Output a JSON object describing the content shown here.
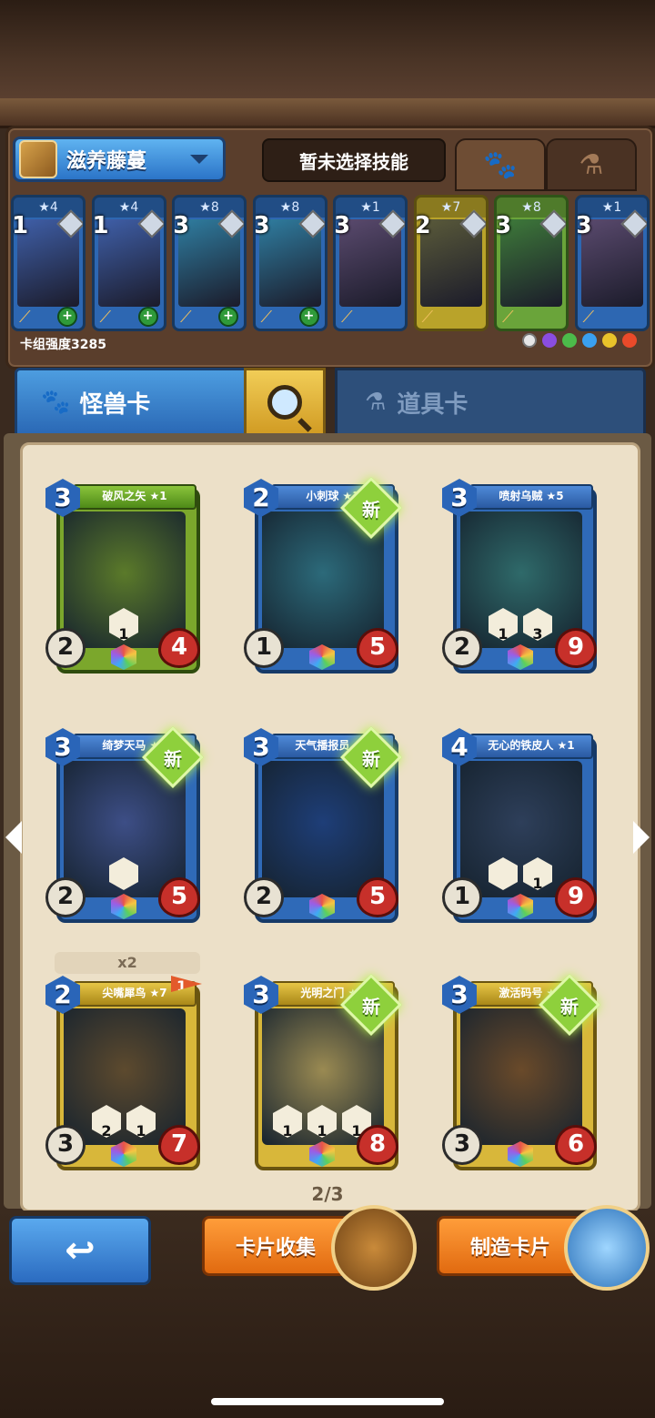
{
  "deck": {
    "name": "滋养藤蔓",
    "skill": "暂未选择技能",
    "power": "卡组强度3285",
    "cards": [
      {
        "cost": "1",
        "stars": "★4",
        "color": "blue",
        "art": "#3f5fa8"
      },
      {
        "cost": "1",
        "stars": "★4",
        "color": "blue",
        "art": "#3f5fa8"
      },
      {
        "cost": "3",
        "stars": "★8",
        "color": "blue",
        "art": "#2f7da0"
      },
      {
        "cost": "3",
        "stars": "★8",
        "color": "blue",
        "art": "#2f7da0"
      },
      {
        "cost": "3",
        "stars": "★1",
        "color": "blue",
        "art": "#5a4a6e"
      },
      {
        "cost": "2",
        "stars": "★7",
        "color": "gold",
        "art": "#5a5a3a"
      },
      {
        "cost": "3",
        "stars": "★8",
        "color": "green",
        "art": "#3e7a3a"
      },
      {
        "cost": "3",
        "stars": "★1",
        "color": "blue",
        "art": "#5a4a6e"
      }
    ]
  },
  "tabs": {
    "monster": "怪兽卡",
    "item": "道具卡"
  },
  "cards": [
    {
      "name": "破风之矢 ★1",
      "cost": "3",
      "atk": "2",
      "hp": "4",
      "type": "green",
      "new": false,
      "art": "#5b7a2a",
      "abil": [
        "1"
      ]
    },
    {
      "name": "小刺球 ★1",
      "cost": "2",
      "atk": "1",
      "hp": "5",
      "type": "blue",
      "new": true,
      "art": "#2c6a7a",
      "abil": []
    },
    {
      "name": "喷射乌贼 ★5",
      "cost": "3",
      "atk": "2",
      "hp": "9",
      "type": "blue",
      "new": false,
      "art": "#2f6a6a",
      "abil": [
        "1",
        "3"
      ]
    },
    {
      "name": "绮梦天马 ★1",
      "cost": "3",
      "atk": "2",
      "hp": "5",
      "type": "blue",
      "new": true,
      "art": "#3d4e86",
      "abil": [
        ""
      ]
    },
    {
      "name": "天气播报员 ★1",
      "cost": "3",
      "atk": "2",
      "hp": "5",
      "type": "blue",
      "new": true,
      "art": "#1e3e78",
      "abil": []
    },
    {
      "name": "无心的铁皮人 ★1",
      "cost": "4",
      "atk": "1",
      "hp": "9",
      "type": "blue",
      "new": false,
      "art": "#2e3f5a",
      "abil": [
        "",
        "1"
      ]
    },
    {
      "name": "尖嘴犀鸟 ★7",
      "cost": "2",
      "atk": "3",
      "hp": "7",
      "type": "gold",
      "new": false,
      "art": "#5d4a2e",
      "abil": [
        "2",
        "1"
      ]
    },
    {
      "name": "光明之门 ★1",
      "cost": "3",
      "atk": "",
      "hp": "8",
      "type": "gold",
      "new": true,
      "art": "#9a8a52",
      "abil": [
        "1",
        "1",
        "1"
      ]
    },
    {
      "name": "激活码号 ★1",
      "cost": "3",
      "atk": "3",
      "hp": "6",
      "type": "gold",
      "new": true,
      "art": "#6a4a2a",
      "abil": []
    }
  ],
  "new_label": "新",
  "copies": "x2",
  "flag_num": "1",
  "page": "2/3",
  "buttons": {
    "collect": "卡片收集",
    "craft": "制造卡片",
    "back": "↩"
  }
}
